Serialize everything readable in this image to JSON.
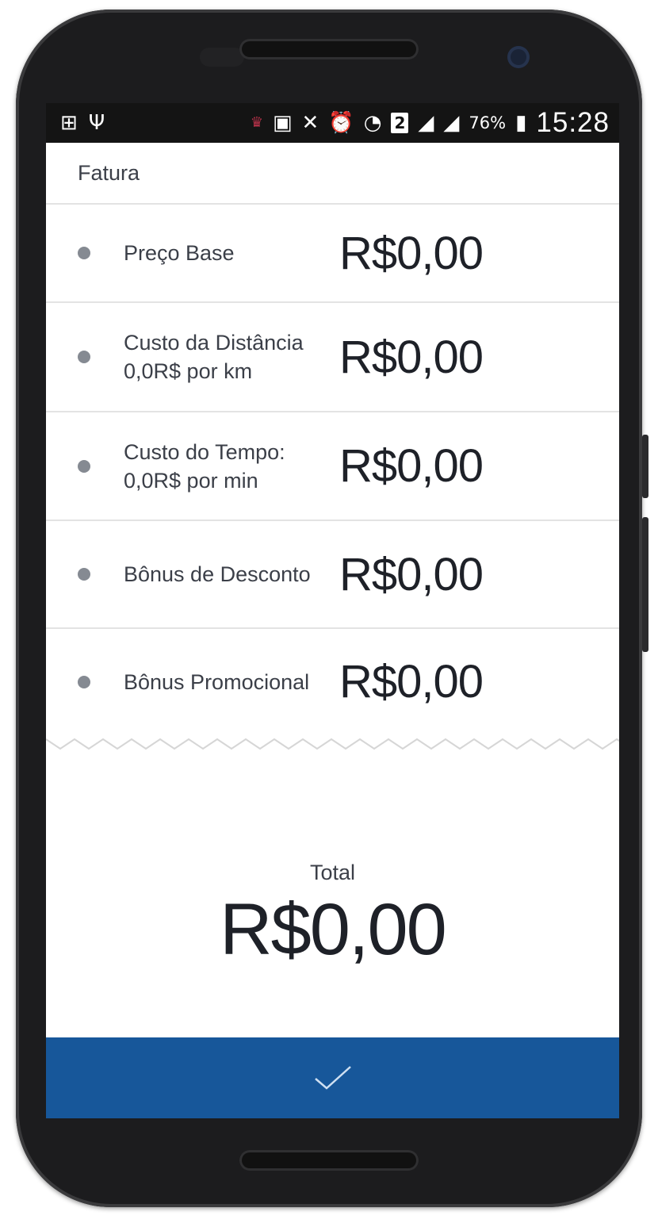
{
  "status_bar": {
    "icons_left": [
      "add-icon",
      "usb-icon"
    ],
    "icons_right": [
      "notification-icon",
      "image-icon",
      "mute-icon",
      "alarm-icon",
      "wifi-icon",
      "sim-2-icon",
      "signal-icon",
      "signal-roaming-icon",
      "battery-charging-icon"
    ],
    "sim_slot": "2",
    "battery": "76%",
    "time": "15:28"
  },
  "invoice": {
    "title": "Fatura",
    "items": [
      {
        "label": "Preço Base",
        "sub": "",
        "amount": "R$0,00"
      },
      {
        "label": "Custo da Distância",
        "sub": "0,0R$ por km",
        "amount": "R$0,00"
      },
      {
        "label": "Custo do Tempo:",
        "sub": "0,0R$ por min",
        "amount": "R$0,00"
      },
      {
        "label": "Bônus de Desconto",
        "sub": "",
        "amount": "R$0,00"
      },
      {
        "label": "Bônus Promocional",
        "sub": "",
        "amount": "R$0,00"
      }
    ]
  },
  "total": {
    "label": "Total",
    "value": "R$0,00"
  },
  "confirm_button": {
    "icon": "checkmark-icon"
  },
  "colors": {
    "accent": "#17579a",
    "text": "#3b3f48",
    "divider": "#e3e3e3",
    "bullet": "#858a92"
  }
}
